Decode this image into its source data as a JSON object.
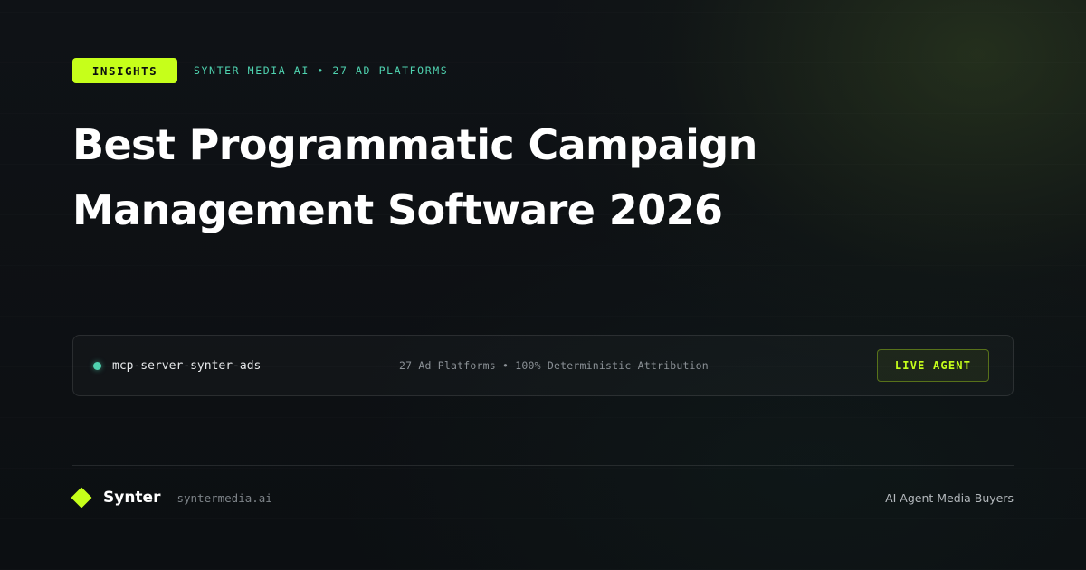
{
  "header": {
    "badge_label": "INSIGHTS",
    "eyebrow": "SYNTER MEDIA AI • 27 AD PLATFORMS"
  },
  "headline": {
    "line1": "Best Programmatic Campaign",
    "line2": "Management Software 2026"
  },
  "terminal": {
    "server_name": "mcp-server-synter-ads",
    "stats": "27 Ad Platforms • 100% Deterministic Attribution",
    "live_button_label": "LIVE AGENT",
    "status_icon": "status-dot-icon"
  },
  "footer": {
    "logo_icon": "diamond-logo-icon",
    "brand": "Synter",
    "domain": "syntermedia.ai",
    "tagline": "AI Agent Media Buyers"
  },
  "colors": {
    "accent_lime": "#c6ff1a",
    "accent_teal": "#4fd3b0",
    "background": "#0c0f13"
  }
}
